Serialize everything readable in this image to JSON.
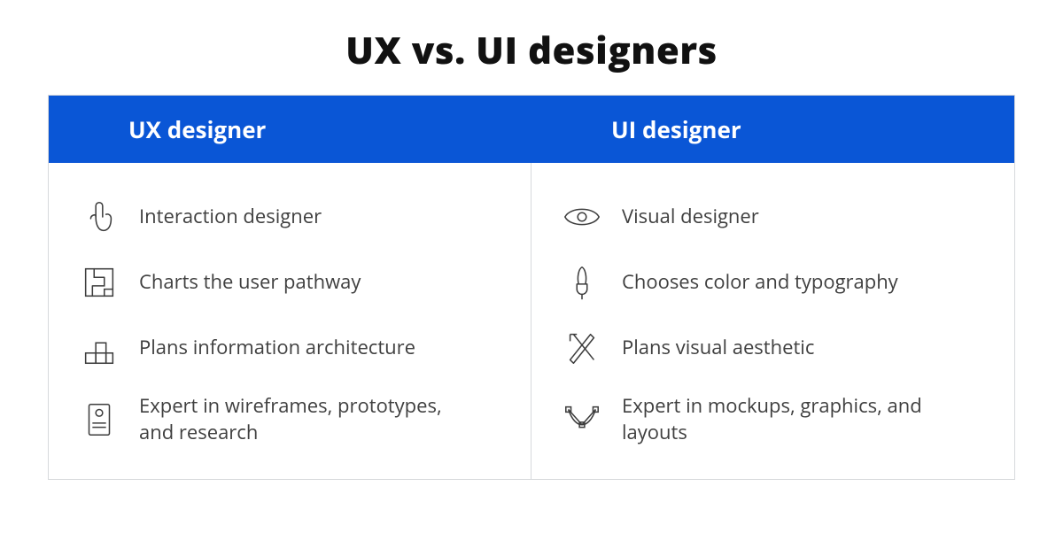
{
  "title": "UX vs. UI designers",
  "columns": {
    "left": {
      "header": "UX designer",
      "items": [
        {
          "icon": "pointer-icon",
          "text": "Interaction designer"
        },
        {
          "icon": "maze-icon",
          "text": "Charts the user pathway"
        },
        {
          "icon": "blocks-icon",
          "text": "Plans information architecture"
        },
        {
          "icon": "wireframe-icon",
          "text": "Expert in wireframes, prototypes, and research"
        }
      ]
    },
    "right": {
      "header": "UI designer",
      "items": [
        {
          "icon": "eye-icon",
          "text": "Visual designer"
        },
        {
          "icon": "brush-icon",
          "text": "Chooses color and typography"
        },
        {
          "icon": "tools-icon",
          "text": "Plans visual aesthetic"
        },
        {
          "icon": "vector-icon",
          "text": "Expert in mockups, graphics, and layouts"
        }
      ]
    }
  },
  "colors": {
    "header_bg": "#0a56d6",
    "border": "#d7d9dc",
    "title_fg": "#111111",
    "body_fg": "#3f3f3f"
  }
}
